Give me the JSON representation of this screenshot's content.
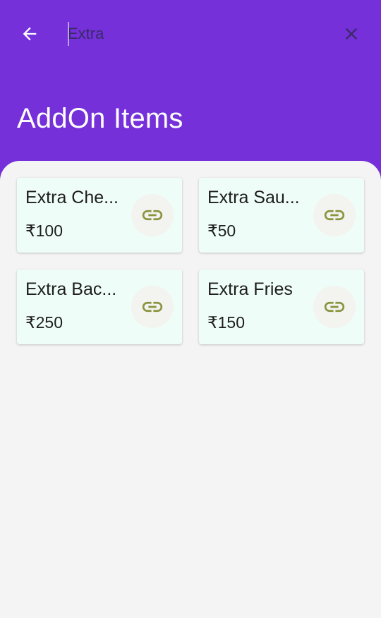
{
  "header": {
    "back_icon": "arrow-left-icon",
    "close_icon": "close-icon",
    "title": "AddOn Items"
  },
  "search": {
    "value": "Extra"
  },
  "items": [
    {
      "name": "Extra Che...",
      "price": "₹100",
      "icon": "link-icon"
    },
    {
      "name": "Extra Sau...",
      "price": "₹50",
      "icon": "link-icon"
    },
    {
      "name": "Extra Bac...",
      "price": "₹250",
      "icon": "link-icon"
    },
    {
      "name": "Extra Fries",
      "price": "₹150",
      "icon": "link-icon"
    }
  ],
  "colors": {
    "primary": "#7530DA",
    "card_background": "#effdf8",
    "page_background": "#f4f4f4",
    "link_icon": "#8a943f"
  }
}
